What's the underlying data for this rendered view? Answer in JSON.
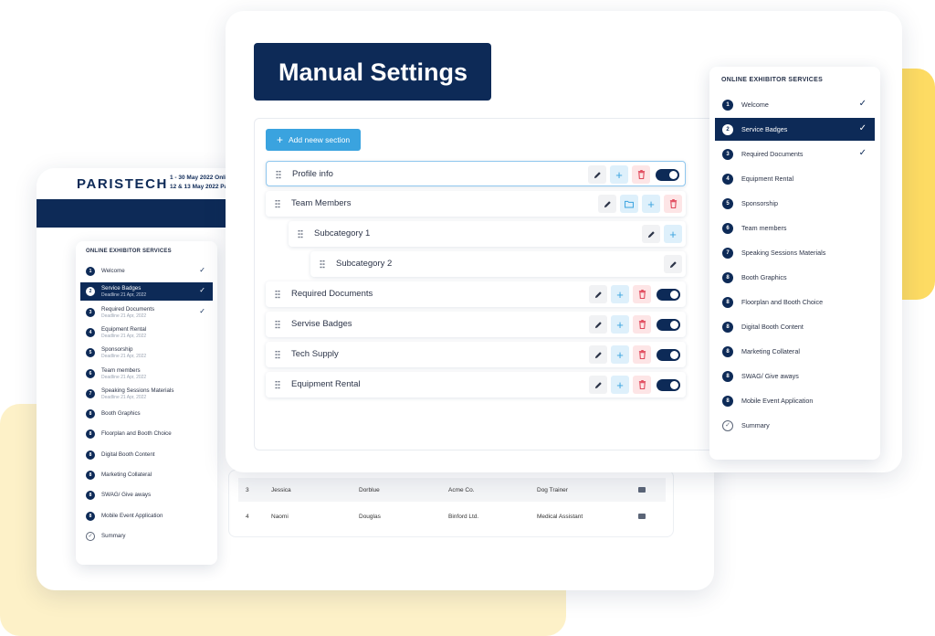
{
  "colors": {
    "navy": "#0d2a57",
    "accent_blue": "#3aa3df",
    "yellow": "#fddb63",
    "cream": "#fdf1c8",
    "danger": "#e0475a"
  },
  "portal": {
    "brand": "PARISTECH",
    "dates": [
      "1 - 30 May 2022 Onli",
      "12 & 13 May 2022 Pa"
    ],
    "table_rows": [
      {
        "num": "3",
        "first": "Jessica",
        "last": "Dorblue",
        "company": "Acme Co.",
        "role": "Dog Trainer"
      },
      {
        "num": "4",
        "first": "Naomi",
        "last": "Douglas",
        "company": "Binford Ltd.",
        "role": "Medical Assistant"
      }
    ]
  },
  "mini_sidebar": {
    "title": "ONLINE EXHIBITOR SERVICES",
    "items": [
      {
        "num": "1",
        "label": "Welcome",
        "deadline": "",
        "check": "✓"
      },
      {
        "num": "2",
        "label": "Service Badges",
        "deadline": "Deadline 21 Apr, 2022",
        "check": "✓"
      },
      {
        "num": "3",
        "label": "Required Documents",
        "deadline": "Deadline 21 Apr, 2022",
        "check": "✓"
      },
      {
        "num": "4",
        "label": "Equipment Rental",
        "deadline": "Deadline 21 Apr, 2022",
        "check": ""
      },
      {
        "num": "5",
        "label": "Sponsorship",
        "deadline": "Deadline 21 Apr, 2022",
        "check": ""
      },
      {
        "num": "6",
        "label": "Team members",
        "deadline": "Deadline 21 Apr, 2022",
        "check": ""
      },
      {
        "num": "7",
        "label": "Speaking Sessions Materials",
        "deadline": "Deadline 21 Apr, 2022",
        "check": ""
      },
      {
        "num": "8",
        "label": "Booth Graphics",
        "deadline": "",
        "check": ""
      },
      {
        "num": "8",
        "label": "Floorplan and Booth Choice",
        "deadline": "",
        "check": ""
      },
      {
        "num": "8",
        "label": "Digital Booth Content",
        "deadline": "",
        "check": ""
      },
      {
        "num": "8",
        "label": "Marketing Collateral",
        "deadline": "",
        "check": ""
      },
      {
        "num": "8",
        "label": "SWAG/ Give aways",
        "deadline": "",
        "check": ""
      },
      {
        "num": "8",
        "label": "Mobile Event Application",
        "deadline": "",
        "check": ""
      },
      {
        "num": "",
        "label": "Summary",
        "deadline": "",
        "check": ""
      }
    ]
  },
  "manual": {
    "title": "Manual Settings",
    "add_section_label": "Add neew section",
    "sections": [
      {
        "label": "Profile info"
      },
      {
        "label": "Team Members"
      },
      {
        "label": "Subcategory 1"
      },
      {
        "label": "Subcategory 2"
      },
      {
        "label": "Required Documents"
      },
      {
        "label": "Servise Badges"
      },
      {
        "label": "Tech Supply"
      },
      {
        "label": "Equipment Rental"
      }
    ]
  },
  "right_sidebar": {
    "title": "ONLINE EXHIBITOR SERVICES",
    "items": [
      {
        "num": "1",
        "label": "Welcome",
        "check": "✓"
      },
      {
        "num": "2",
        "label": "Service Badges",
        "check": "✓"
      },
      {
        "num": "3",
        "label": "Required Documents",
        "check": "✓"
      },
      {
        "num": "4",
        "label": "Equipment Rental",
        "check": ""
      },
      {
        "num": "5",
        "label": "Sponsorship",
        "check": ""
      },
      {
        "num": "6",
        "label": "Team members",
        "check": ""
      },
      {
        "num": "7",
        "label": "Speaking Sessions Materials",
        "check": ""
      },
      {
        "num": "8",
        "label": "Booth Graphics",
        "check": ""
      },
      {
        "num": "8",
        "label": "Floorplan and Booth Choice",
        "check": ""
      },
      {
        "num": "8",
        "label": "Digital Booth Content",
        "check": ""
      },
      {
        "num": "8",
        "label": "Marketing Collateral",
        "check": ""
      },
      {
        "num": "8",
        "label": "SWAG/ Give aways",
        "check": ""
      },
      {
        "num": "8",
        "label": "Mobile Event Application",
        "check": ""
      },
      {
        "num": "",
        "label": "Summary",
        "check": ""
      }
    ]
  }
}
